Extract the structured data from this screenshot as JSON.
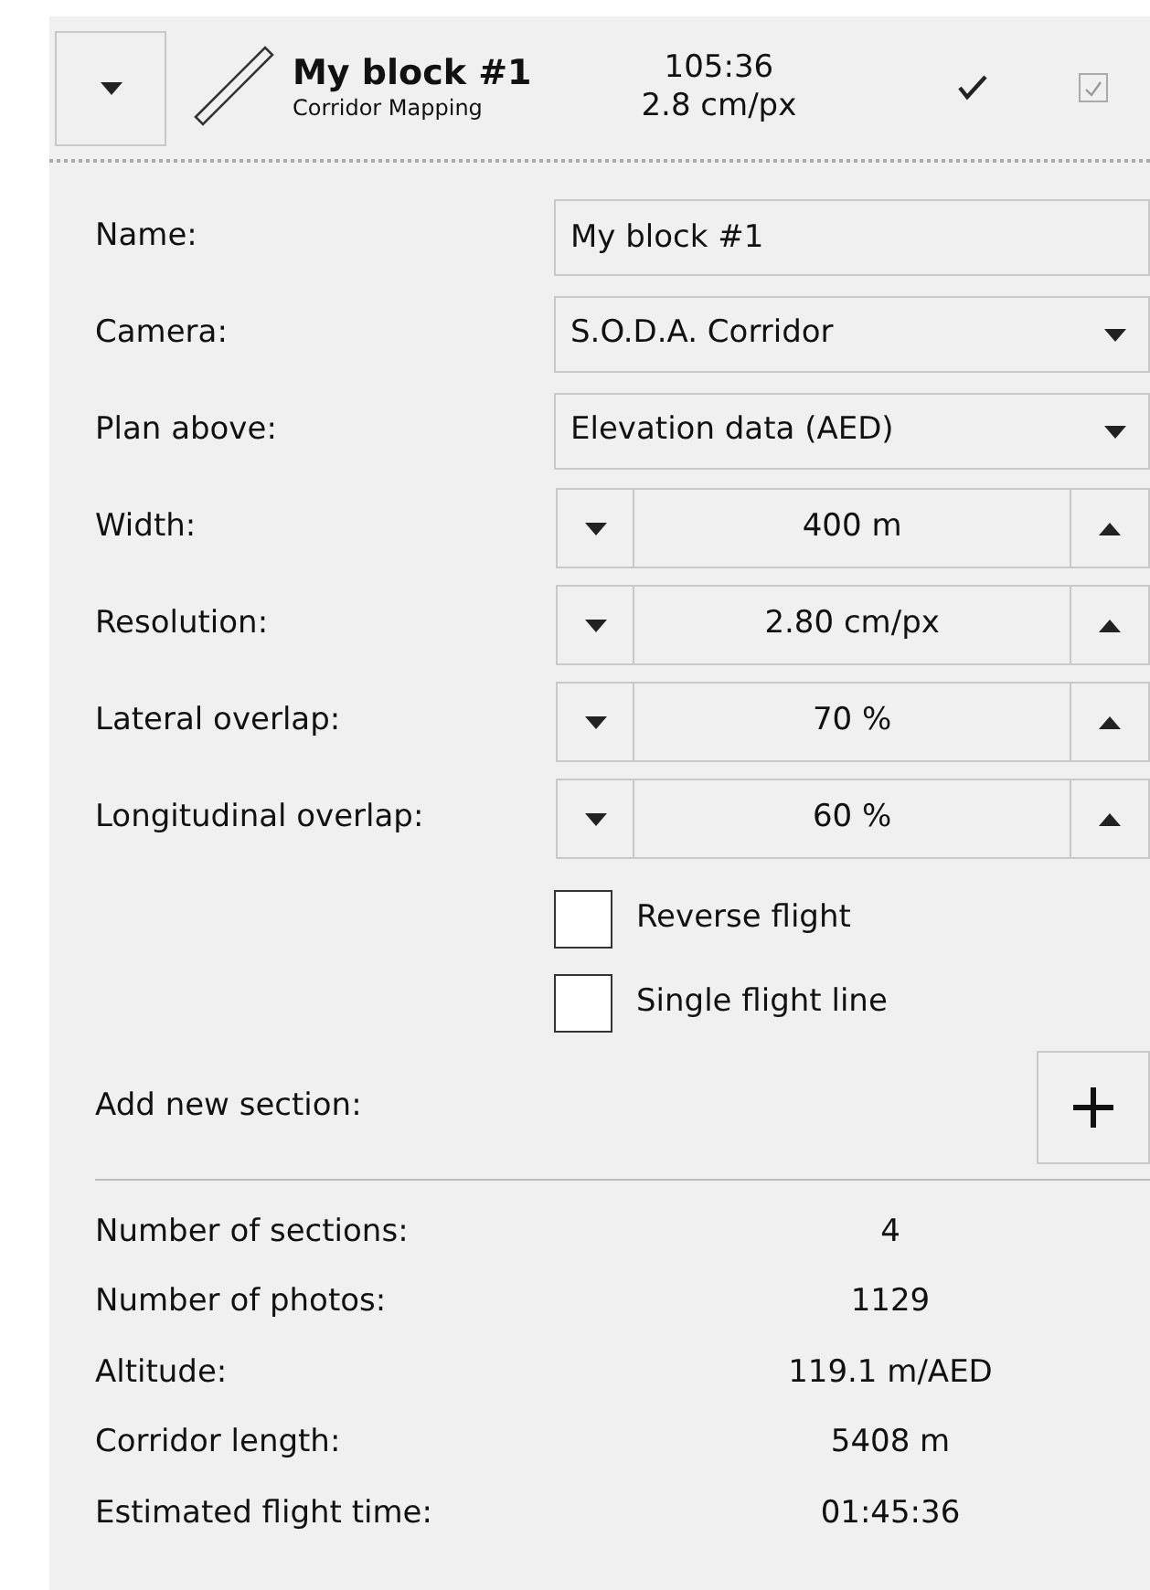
{
  "header": {
    "title": "My block #1",
    "subtitle": "Corridor Mapping",
    "time": "105:36",
    "resolution": "2.8 cm/px",
    "enabled_checkbox": true
  },
  "fields": [
    {
      "label": "Name:",
      "kind": "text",
      "value": "My block #1"
    },
    {
      "label": "Camera:",
      "kind": "dropdown",
      "value": "S.O.D.A. Corridor"
    },
    {
      "label": "Plan above:",
      "kind": "dropdown",
      "value": "Elevation data (AED)"
    },
    {
      "label": "Width:",
      "kind": "spinner",
      "value": "400 m"
    },
    {
      "label": "Resolution:",
      "kind": "spinner",
      "value": "2.80 cm/px"
    },
    {
      "label": "Lateral overlap:",
      "kind": "spinner",
      "value": "70 %"
    },
    {
      "label": "Longitudinal overlap:",
      "kind": "spinner",
      "value": "60 %"
    }
  ],
  "options": [
    {
      "label": "Reverse flight",
      "checked": false
    },
    {
      "label": "Single flight line",
      "checked": false
    }
  ],
  "add_section": {
    "label": "Add new section:"
  },
  "stats": [
    {
      "label": "Number of sections:",
      "value": "4"
    },
    {
      "label": "Number of photos:",
      "value": "1129"
    },
    {
      "label": "Altitude:",
      "value": "119.1 m/AED"
    },
    {
      "label": "Corridor length:",
      "value": "5408 m"
    },
    {
      "label": "Estimated flight time:",
      "value": "01:45:36"
    }
  ]
}
